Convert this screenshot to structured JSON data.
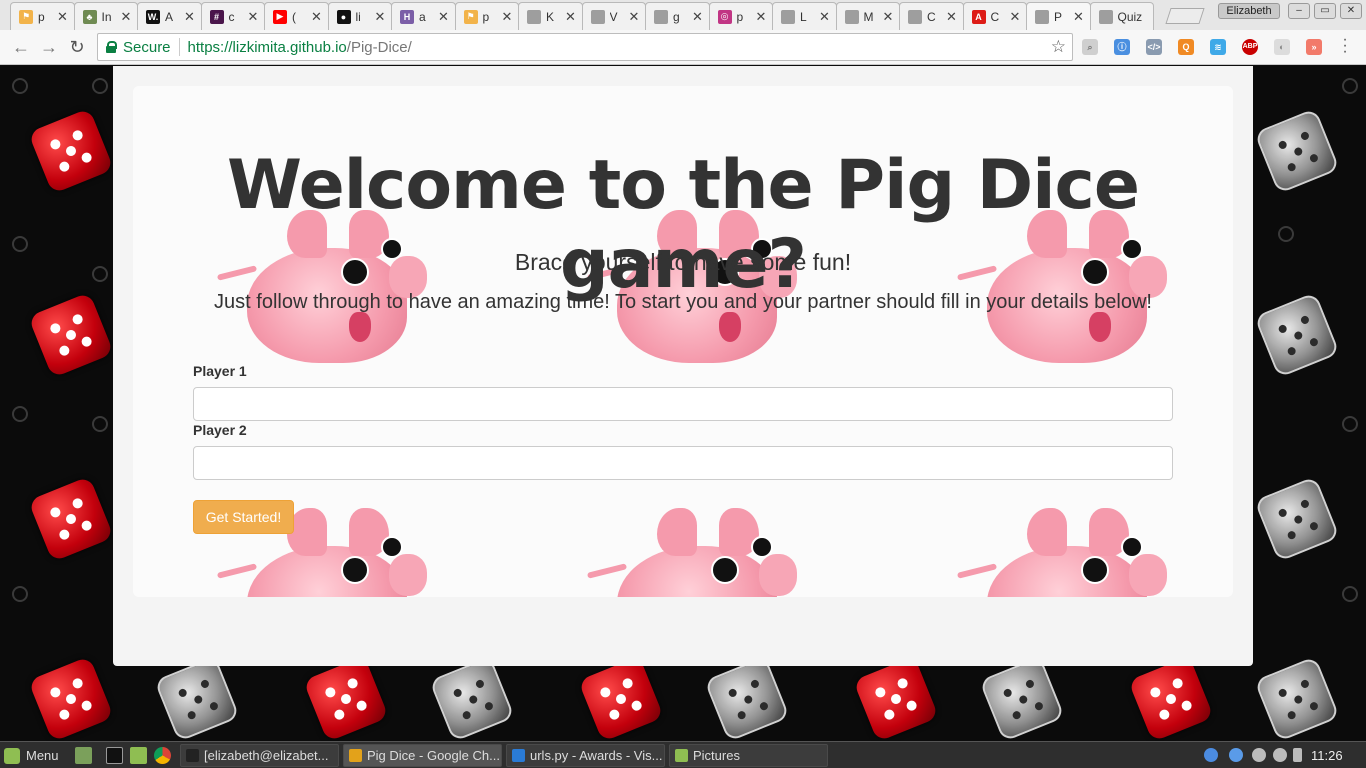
{
  "browser": {
    "tabs": [
      {
        "label": "p",
        "color": "#f2b34a",
        "glyph": "⚑"
      },
      {
        "label": "In",
        "color": "#6f8a52",
        "glyph": "♣"
      },
      {
        "label": "A",
        "color": "#111111",
        "glyph": "W."
      },
      {
        "label": "c",
        "color": "#4a154b",
        "glyph": "#"
      },
      {
        "label": "(",
        "color": "#ff0000",
        "glyph": "▶"
      },
      {
        "label": "li",
        "color": "#111111",
        "glyph": "●"
      },
      {
        "label": "a",
        "color": "#7b5ea7",
        "glyph": "H"
      },
      {
        "label": "p",
        "color": "#f2b34a",
        "glyph": "⚑"
      },
      {
        "label": "K",
        "color": "#9e9e9e",
        "glyph": ""
      },
      {
        "label": "V",
        "color": "#9e9e9e",
        "glyph": ""
      },
      {
        "label": "g",
        "color": "#9e9e9e",
        "glyph": ""
      },
      {
        "label": "p",
        "color": "#c13584",
        "glyph": "◎"
      },
      {
        "label": "L",
        "color": "#9e9e9e",
        "glyph": ""
      },
      {
        "label": "M",
        "color": "#9e9e9e",
        "glyph": ""
      },
      {
        "label": "C",
        "color": "#9e9e9e",
        "glyph": ""
      },
      {
        "label": "C",
        "color": "#dd1b16",
        "glyph": "A"
      },
      {
        "label": "P",
        "color": "#9e9e9e",
        "glyph": ""
      },
      {
        "label": "Quiz",
        "color": "#9e9e9e",
        "glyph": ""
      }
    ],
    "active_tab_index": 16,
    "profile_name": "Elizabeth",
    "secure_label": "Secure",
    "url_host": "https://lizkimita.github.io",
    "url_path": "/Pig-Dice/"
  },
  "page": {
    "headline": "Welcome to the Pig Dice game?",
    "subtitle": "Brace yourself to have some fun!",
    "instructions": "Just follow through to have an amazing time! To start you and your partner should fill in your details below!",
    "player1_label": "Player 1",
    "player1_value": "",
    "player2_label": "Player 2",
    "player2_value": "",
    "start_button": "Get Started!"
  },
  "taskbar": {
    "menu_label": "Menu",
    "tasks": [
      {
        "label": "[elizabeth@elizabet...",
        "color": "#222222"
      },
      {
        "label": "Pig Dice - Google Ch...",
        "color": "#e3a21a"
      },
      {
        "label": "urls.py - Awards - Vis...",
        "color": "#2a7bd6"
      },
      {
        "label": "Pictures",
        "color": "#8fbe52"
      }
    ],
    "active_task_index": 1,
    "clock": "11:26"
  },
  "colors": {
    "accent_button": "#f0ad4e",
    "secure_green": "#0b8043"
  }
}
